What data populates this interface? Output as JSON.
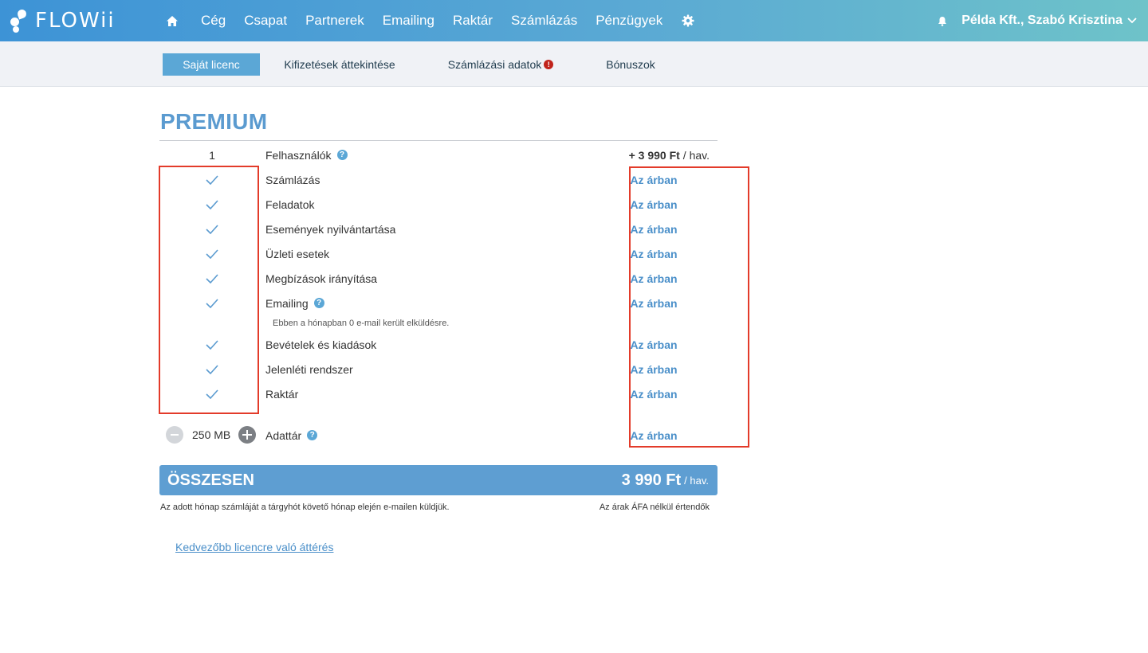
{
  "topbar": {
    "logo_text": "FLOWii",
    "nav": [
      "Cég",
      "Csapat",
      "Partnerek",
      "Emailing",
      "Raktár",
      "Számlázás",
      "Pénzügyek"
    ],
    "user": "Példa Kft., Szabó Krisztina",
    "icons": {
      "home": "home-icon",
      "settings": "gear-icon",
      "notifications": "bell-icon",
      "menu": "chevron-down-icon"
    }
  },
  "subnav": {
    "tabs": [
      "Saját licenc",
      "Kifizetések áttekintése",
      "Számlázási adatok",
      "Bónuszok"
    ],
    "active_tab": "Saját licenc",
    "alert_mark": "!"
  },
  "license": {
    "plan": "PREMIUM",
    "users": {
      "count": "1",
      "label": "Felhasználók",
      "price_value": "+ 3 990 Ft",
      "price_unit": "/ hav."
    },
    "features": [
      {
        "name": "Számlázás",
        "price": "Az árban"
      },
      {
        "name": "Feladatok",
        "price": "Az árban"
      },
      {
        "name": "Események nyilvántartása",
        "price": "Az árban"
      },
      {
        "name": "Üzleti esetek",
        "price": "Az árban"
      },
      {
        "name": "Megbízások irányítása",
        "price": "Az árban"
      },
      {
        "name": "Emailing",
        "price": "Az árban"
      },
      {
        "name": "Bevételek és kiadások",
        "price": "Az árban"
      },
      {
        "name": "Jelenléti rendszer",
        "price": "Az árban"
      },
      {
        "name": "Raktár",
        "price": "Az árban"
      }
    ],
    "emailing_note": "Ebben a hónapban 0 e-mail került elküldésre.",
    "storage": {
      "value": "250 MB",
      "label": "Adattár",
      "price": "Az árban"
    },
    "help_mark": "?",
    "total": {
      "label": "ÖSSZESEN",
      "amount": "3 990 Ft",
      "unit": "/ hav."
    },
    "footnote_left": "Az adott hónap számláját a tárgyhót követő hónap elején e-mailen küldjük.",
    "footnote_right": "Az árak ÁFA nélkül értendők",
    "switch_link": "Kedvezőbb licencre való áttérés"
  },
  "colors": {
    "accent": "#5ba7d6",
    "highlight_box": "#e33b2a",
    "total_bar": "#5e9ed2",
    "alert": "#c0231b"
  }
}
